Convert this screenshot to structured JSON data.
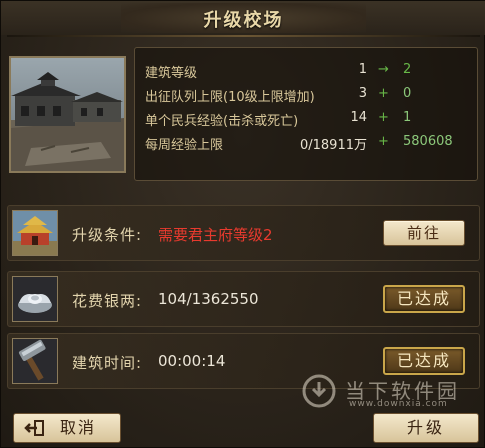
{
  "dialog": {
    "title": "升级校场"
  },
  "stats": [
    {
      "label": "建筑等级",
      "current": "1",
      "symbol": "→",
      "next": "2"
    },
    {
      "label": "出征队列上限(10级上限增加)",
      "current": "3",
      "symbol": "+",
      "next": "0"
    },
    {
      "label": "单个民兵经验(击杀或死亡)",
      "current": "14",
      "symbol": "+",
      "next": "1"
    },
    {
      "label": "每周经验上限",
      "current": "0/18911万",
      "symbol": "+",
      "next": "580608"
    }
  ],
  "requirements": {
    "condition": {
      "label": "升级条件:",
      "value": "需要君主府等级2",
      "button": "前往"
    },
    "silver": {
      "label": "花费银两:",
      "value": "104/1362550",
      "status": "已达成"
    },
    "time": {
      "label": "建筑时间:",
      "value": "00:00:14",
      "status": "已达成"
    }
  },
  "footer": {
    "cancel_label": "取消",
    "upgrade_label": "升级"
  },
  "watermark": {
    "text": "当下软件园",
    "url": "www.downxia.com"
  },
  "icons": {
    "building": "training-ground-building-icon",
    "palace": "palace-icon",
    "silver": "silver-ingot-icon",
    "hammer": "hammer-icon",
    "back": "back-arrow-icon"
  },
  "colors": {
    "requirement_unmet": "#e83a2e",
    "increase": "#68b848",
    "title": "#e8d7a8"
  }
}
